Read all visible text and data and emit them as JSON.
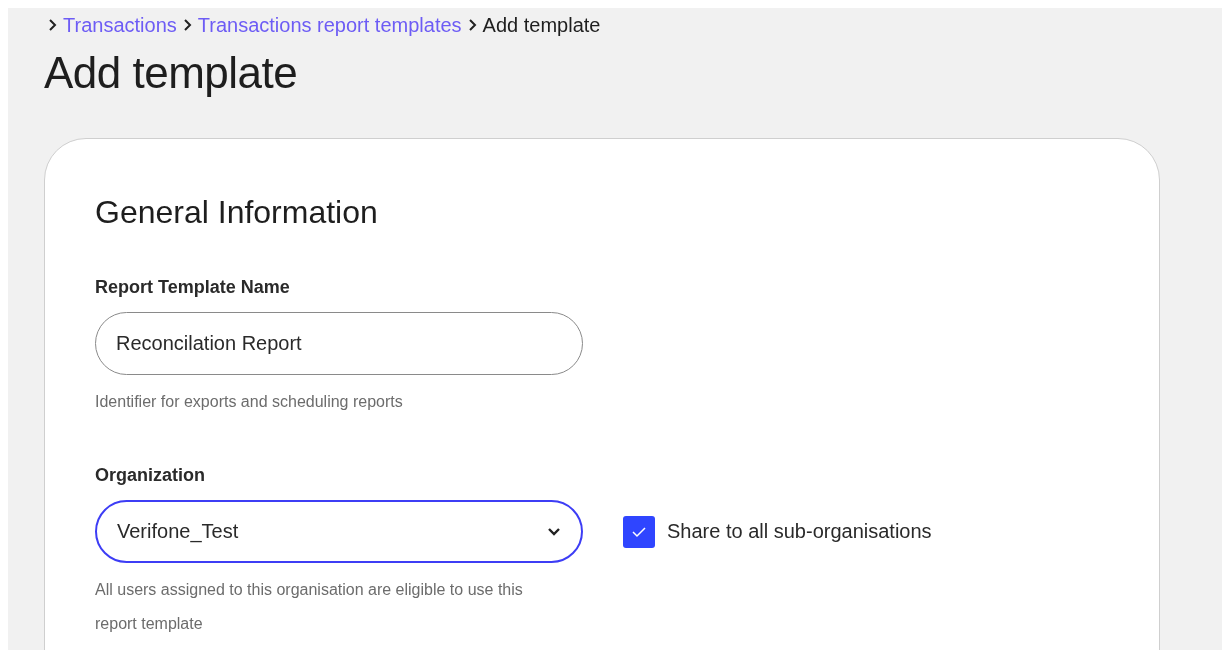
{
  "breadcrumb": [
    {
      "label": "Transactions",
      "kind": "link"
    },
    {
      "label": "Transactions report templates",
      "kind": "link"
    },
    {
      "label": "Add template",
      "kind": "current"
    }
  ],
  "page_title": "Add template",
  "card": {
    "title": "General Information",
    "fields": [
      {
        "kind": "text",
        "label": "Report Template Name",
        "value": "Reconcilation Report",
        "focused": false,
        "hint": "Identifier for exports and scheduling reports"
      },
      {
        "kind": "select",
        "label": "Organization",
        "value": "Verifone_Test",
        "focused": true,
        "hint": "All users assigned to this organisation are eligible to use this report template",
        "checkbox": {
          "label": "Share to all sub-organisations",
          "checked": true
        }
      }
    ]
  }
}
